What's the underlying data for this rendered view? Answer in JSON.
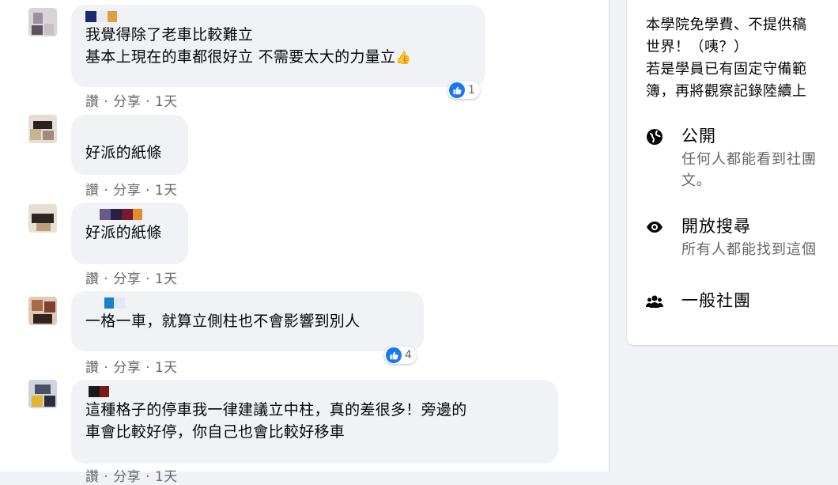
{
  "comments": [
    {
      "lines": [
        "我覺得除了老車比較難立",
        "基本上現在的車都很好立 不需要太大的力量立"
      ],
      "emoji": "👍",
      "actions": "讚 · 分享 · 1天",
      "reaction_count": "1"
    },
    {
      "lines": [
        "好派的紙條"
      ],
      "actions": "讚 · 分享 · 1天"
    },
    {
      "lines": [
        "好派的紙條"
      ],
      "actions": "讚 · 分享 · 1天"
    },
    {
      "lines": [
        "一格一車，就算立側柱也不會影響到別人"
      ],
      "actions": "讚 · 分享 · 1天",
      "reaction_count": "4"
    },
    {
      "lines": [
        "這種格子的停車我一律建議立中柱，真的差很多！旁邊的",
        "車會比較好停，你自己也會比較好移車"
      ],
      "actions": "讚 · 分享 · 1天"
    }
  ],
  "sidebar": {
    "description": [
      "本學院免學費、不提供稿",
      "世界！（咦？）",
      "若是學員已有固定守備範",
      "簿，再將觀察記錄陸續上"
    ],
    "privacy": {
      "title": "公開",
      "subtitle": [
        "任何人都能看到社團",
        "文。"
      ],
      "icon": "globe-icon"
    },
    "visibility": {
      "title": "開放搜尋",
      "subtitle": [
        "所有人都能找到這個"
      ],
      "icon": "eye-icon"
    },
    "type": {
      "title": "一般社團",
      "icon": "group-icon"
    }
  },
  "colors": {
    "like_blue": "#1877f2",
    "bubble_bg": "#f0f2f5",
    "secondary_text": "#65676b"
  }
}
